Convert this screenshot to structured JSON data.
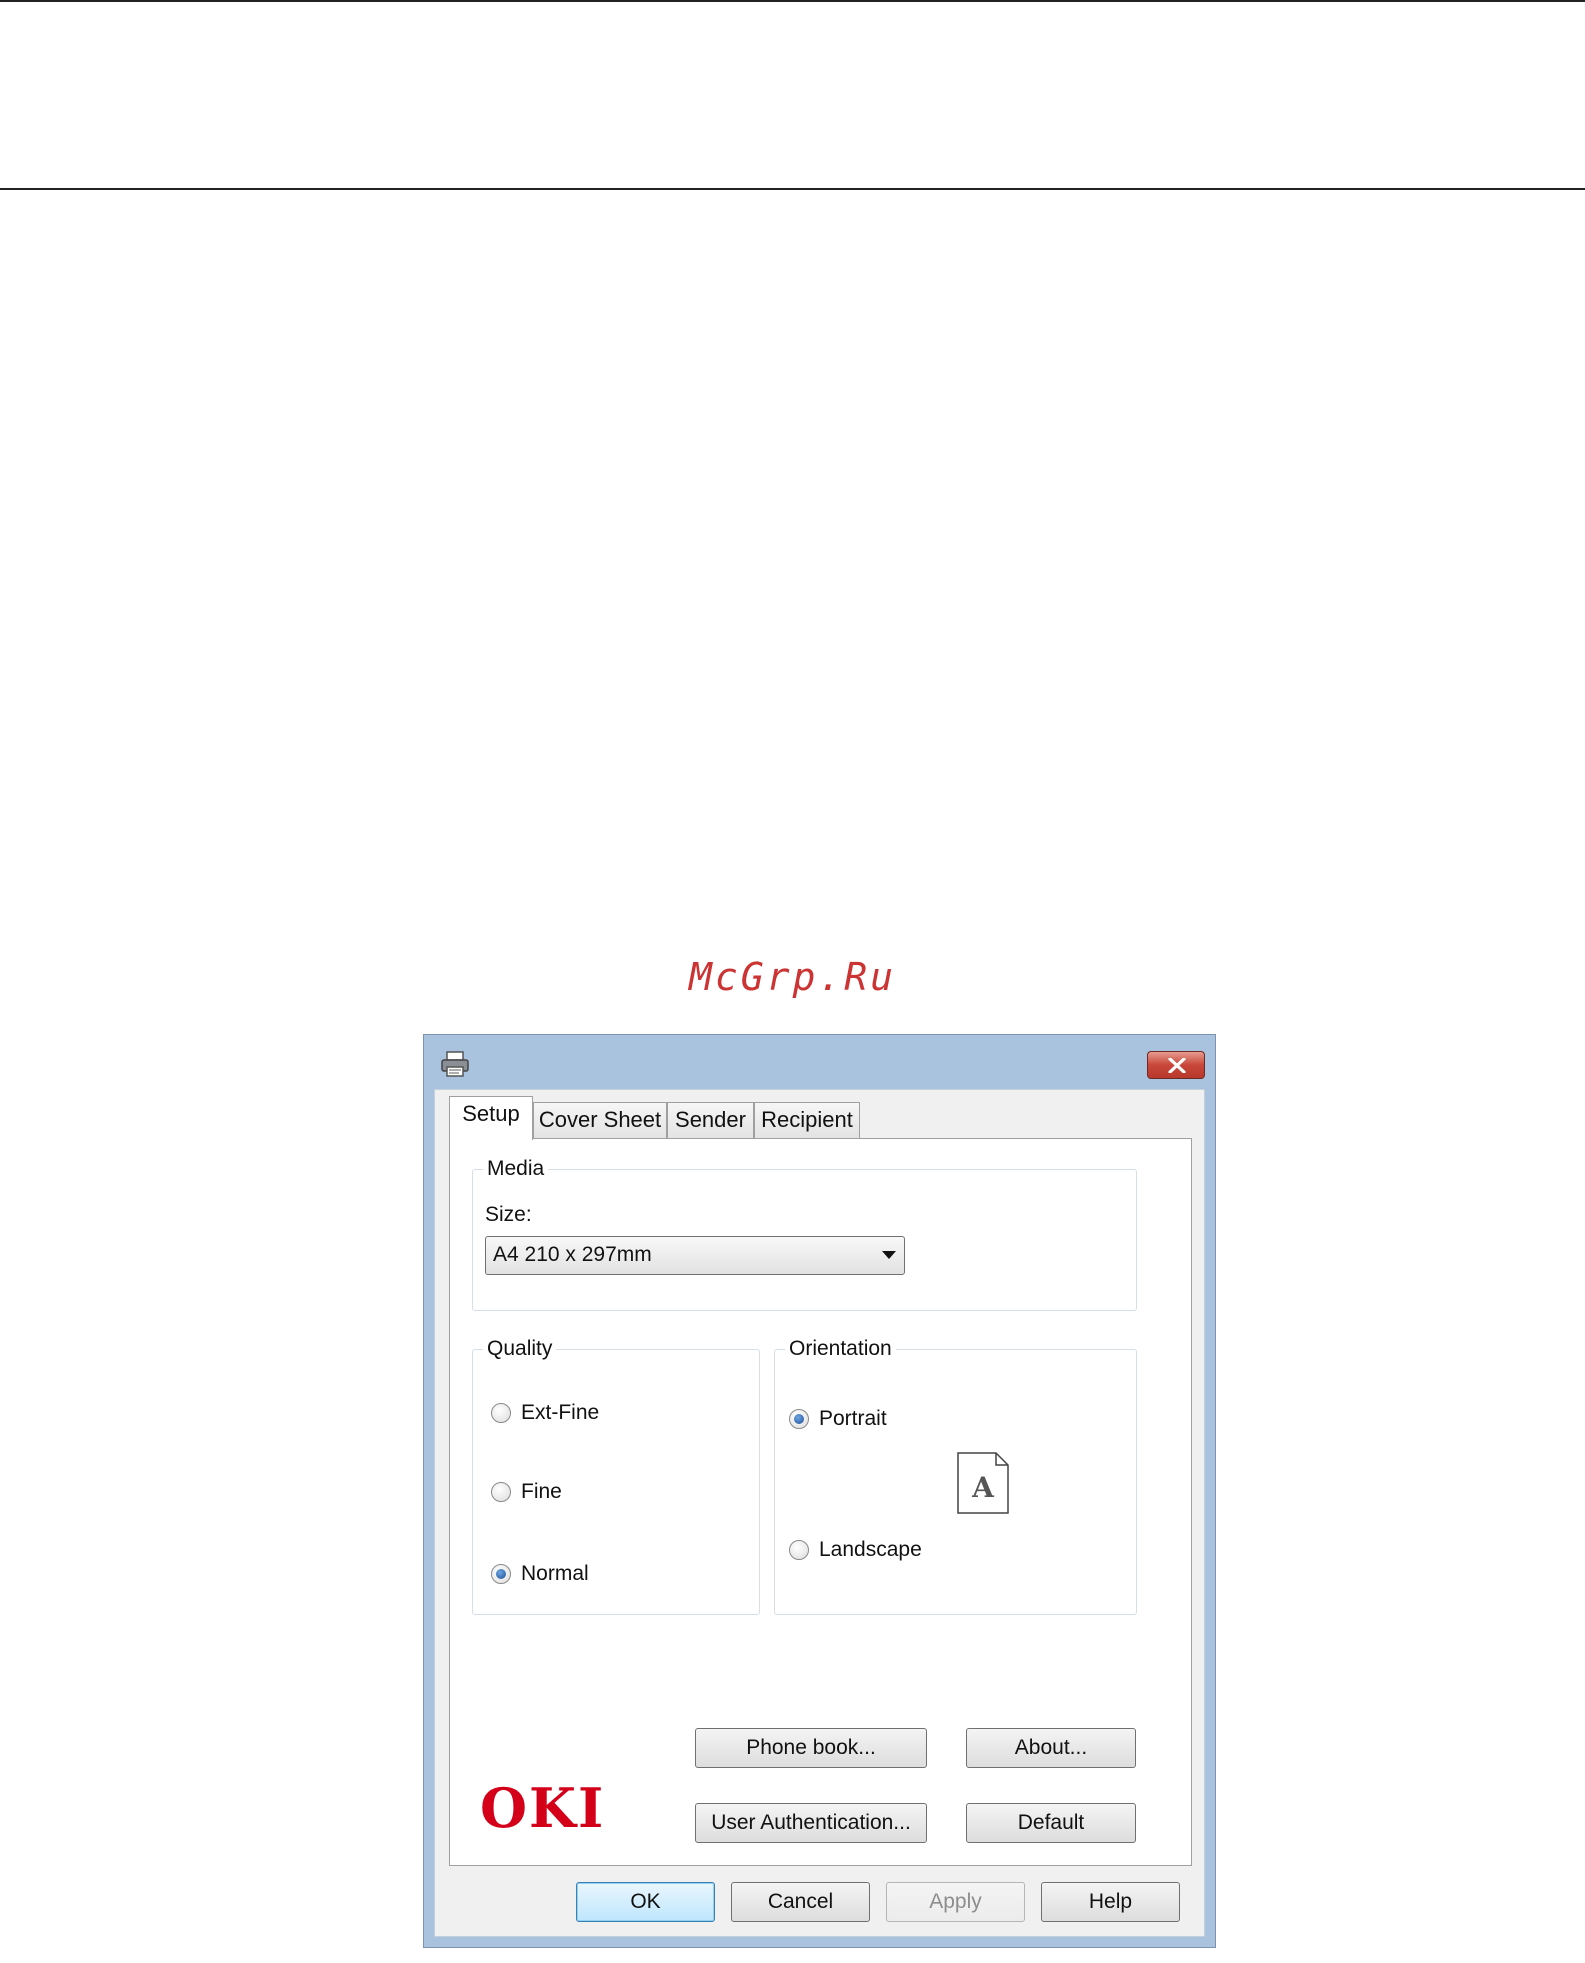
{
  "watermark": "McGrp.Ru",
  "dialog": {
    "tabs": [
      {
        "label": "Setup",
        "active": true
      },
      {
        "label": "Cover Sheet",
        "active": false
      },
      {
        "label": "Sender",
        "active": false
      },
      {
        "label": "Recipient",
        "active": false
      }
    ],
    "media": {
      "legend": "Media",
      "size_label": "Size:",
      "size_value": "A4 210 x 297mm"
    },
    "quality": {
      "legend": "Quality",
      "options": [
        {
          "label": "Ext-Fine",
          "checked": false
        },
        {
          "label": "Fine",
          "checked": false
        },
        {
          "label": "Normal",
          "checked": true
        }
      ]
    },
    "orientation": {
      "legend": "Orientation",
      "options": [
        {
          "label": "Portrait",
          "checked": true
        },
        {
          "label": "Landscape",
          "checked": false
        }
      ],
      "preview_letter": "A"
    },
    "buttons": {
      "phone_book": "Phone book...",
      "about": "About...",
      "user_authentication": "User Authentication...",
      "default": "Default"
    },
    "footer": {
      "ok": "OK",
      "cancel": "Cancel",
      "apply": "Apply",
      "help": "Help"
    },
    "logo_text": "OKI",
    "colors": {
      "title_bar": "#a9c3de",
      "close_button": "#c8473a",
      "logo_red": "#d4001a",
      "radio_checked": "#1b4f9a"
    },
    "icons": {
      "title": "printer-icon",
      "close": "close-icon",
      "dropdown": "chevron-down-icon",
      "preview": "page-portrait-icon"
    }
  }
}
